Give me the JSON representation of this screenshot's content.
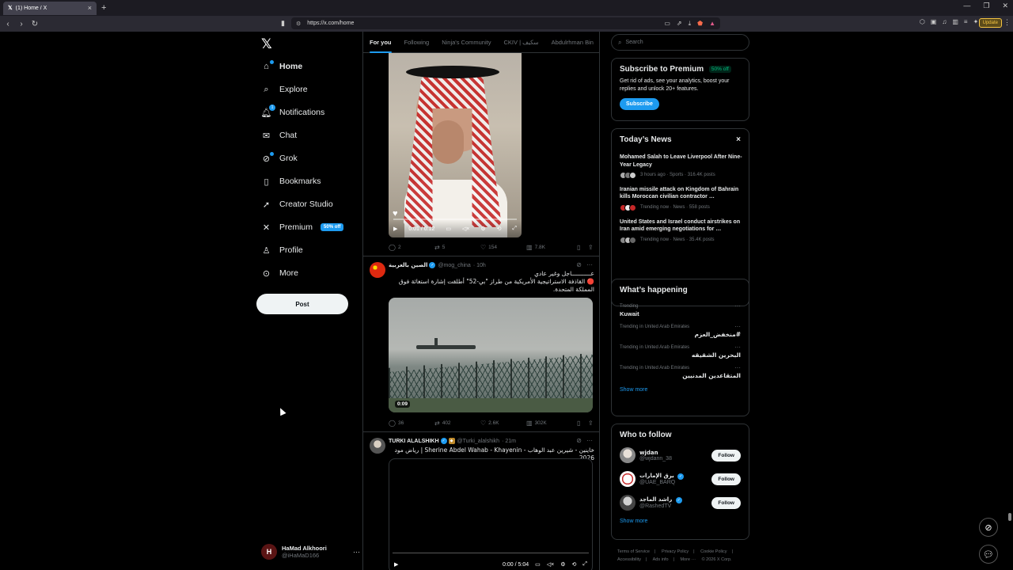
{
  "browser": {
    "tab_title": "(1) Home / X",
    "tab_close": "×",
    "new_tab": "+",
    "url": "https://x.com/home",
    "update_label": "Update"
  },
  "nav": {
    "items": [
      {
        "label": "Home",
        "icon": "home-icon"
      },
      {
        "label": "Explore",
        "icon": "search-icon"
      },
      {
        "label": "Notifications",
        "icon": "bell-icon",
        "badge": "1"
      },
      {
        "label": "Chat",
        "icon": "mail-icon"
      },
      {
        "label": "Grok",
        "icon": "grok-icon"
      },
      {
        "label": "Bookmarks",
        "icon": "bookmark-icon"
      },
      {
        "label": "Creator Studio",
        "icon": "rocket-icon"
      },
      {
        "label": "Premium",
        "icon": "x-icon",
        "badge": "50% off"
      },
      {
        "label": "Profile",
        "icon": "person-icon"
      },
      {
        "label": "More",
        "icon": "more-circle-icon"
      }
    ],
    "post_label": "Post",
    "account": {
      "name": "HaMad Alkhoori",
      "handle": "@iHaMaD166",
      "initials": "H"
    }
  },
  "feed": {
    "tabs": [
      "For you",
      "Following",
      "Ninja's Community",
      "CKIV | سكيف",
      "Abdulrhman Bin"
    ],
    "active_tab": "For you",
    "video1": {
      "time": "0:01 / 0:12",
      "actions": {
        "replies": "2",
        "reposts": "5",
        "likes": "154",
        "views": "7.8K"
      }
    },
    "tweet2": {
      "name": "الصين بالعربية",
      "handle": "@mog_china",
      "time": "· 10h",
      "line1": "عـــــــــــاجل وغير عادي",
      "line2": "🔴 القاذفة الاستراتيجية الأمريكية من طراز \"بي-52\" أطلقت إشارة استغاثة فوق المملكة المتحدة.",
      "video_duration": "0:09",
      "actions": {
        "replies": "36",
        "reposts": "402",
        "likes": "2.6K",
        "views": "302K"
      }
    },
    "tweet3": {
      "name": "TURKI ALALSHIKH",
      "handle": "@Turki_alalshikh",
      "time": "· 21m",
      "text": "خاينين - شيرين عبد الوهاب - Sherine Abdel Wahab - Khayenin | رياض مود 2026",
      "video_time": "0:00 / 5:04"
    }
  },
  "sidebar": {
    "search_placeholder": "Search",
    "premium": {
      "title": "Subscribe to Premium",
      "badge": "50% off",
      "desc": "Get rid of ads, see your analytics, boost your replies and unlock 20+ features.",
      "button": "Subscribe"
    },
    "news": {
      "title": "Today’s News",
      "close": "×",
      "items": [
        {
          "title": "Mohamed Salah to Leave Liverpool After Nine-Year Legacy",
          "meta": "3 hours ago · Sports · 316.4K posts"
        },
        {
          "title": "Iranian missile attack on Kingdom of Bahrain kills Moroccan civilian contractor …",
          "meta": "Trending now · News · 558 posts"
        },
        {
          "title": "United States and Israel conduct airstrikes on Iran amid emerging negotiations for …",
          "meta": "Trending now · News · 35.4K posts"
        }
      ]
    },
    "happening": {
      "title": "What’s happening",
      "trends": [
        {
          "meta": "Trending",
          "name": "Kuwait",
          "rtl": false
        },
        {
          "meta": "Trending in United Arab Emirates",
          "name": "#منخفض_العزم",
          "rtl": true
        },
        {
          "meta": "Trending in United Arab Emirates",
          "name": "البحرين الشقيقه",
          "rtl": true
        },
        {
          "meta": "Trending in United Arab Emirates",
          "name": "المتقاعدين المدنيين",
          "rtl": true
        }
      ],
      "show_more": "Show more"
    },
    "who_to_follow": {
      "title": "Who to follow",
      "accounts": [
        {
          "name": "wjdan",
          "handle": "@wjdann_38",
          "button": "Follow",
          "verified": false
        },
        {
          "name": "برق الإمارات",
          "handle": "@UAE_BARQ",
          "button": "Follow",
          "verified": true
        },
        {
          "name": "راشد الماجد",
          "handle": "@RashedTV",
          "button": "Follow",
          "verified": true
        }
      ],
      "show_more": "Show more"
    },
    "footer": [
      "Terms of Service",
      "|",
      "Privacy Policy",
      "|",
      "Cookie Policy",
      "|",
      "Accessibility",
      "|",
      "Ads info",
      "|",
      "More ···",
      "© 2026 X Corp."
    ]
  }
}
